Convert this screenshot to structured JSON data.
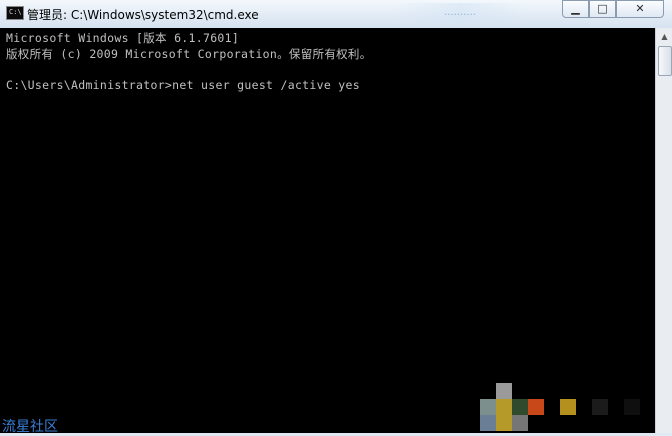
{
  "window": {
    "title": "管理员: C:\\Windows\\system32\\cmd.exe",
    "icon_text": "C:\\",
    "background_tab_text": "..........",
    "buttons": {
      "minimize_glyph": "▁",
      "maximize_glyph": "□",
      "close_glyph": "✕"
    }
  },
  "console": {
    "lines": [
      "Microsoft Windows [版本 6.1.7601]",
      "版权所有 (c) 2009 Microsoft Corporation。保留所有权利。",
      "C:\\Users\\Administrator>net user guest /active yes"
    ],
    "text_color": "#c0c0c0",
    "background_color": "#000000"
  },
  "scrollbar": {
    "up_glyph": "▲"
  },
  "watermark": {
    "text": "流星社区",
    "color": "#3a7fd6"
  },
  "pixelation_colors": [
    "#9a9a9a",
    "#7d8f8c",
    "#b59a2a",
    "#2f4a2c",
    "#c8481a",
    "#b4901e",
    "#6a7f95",
    "#1b1b1b",
    "#0f0f0f",
    "#767676"
  ]
}
